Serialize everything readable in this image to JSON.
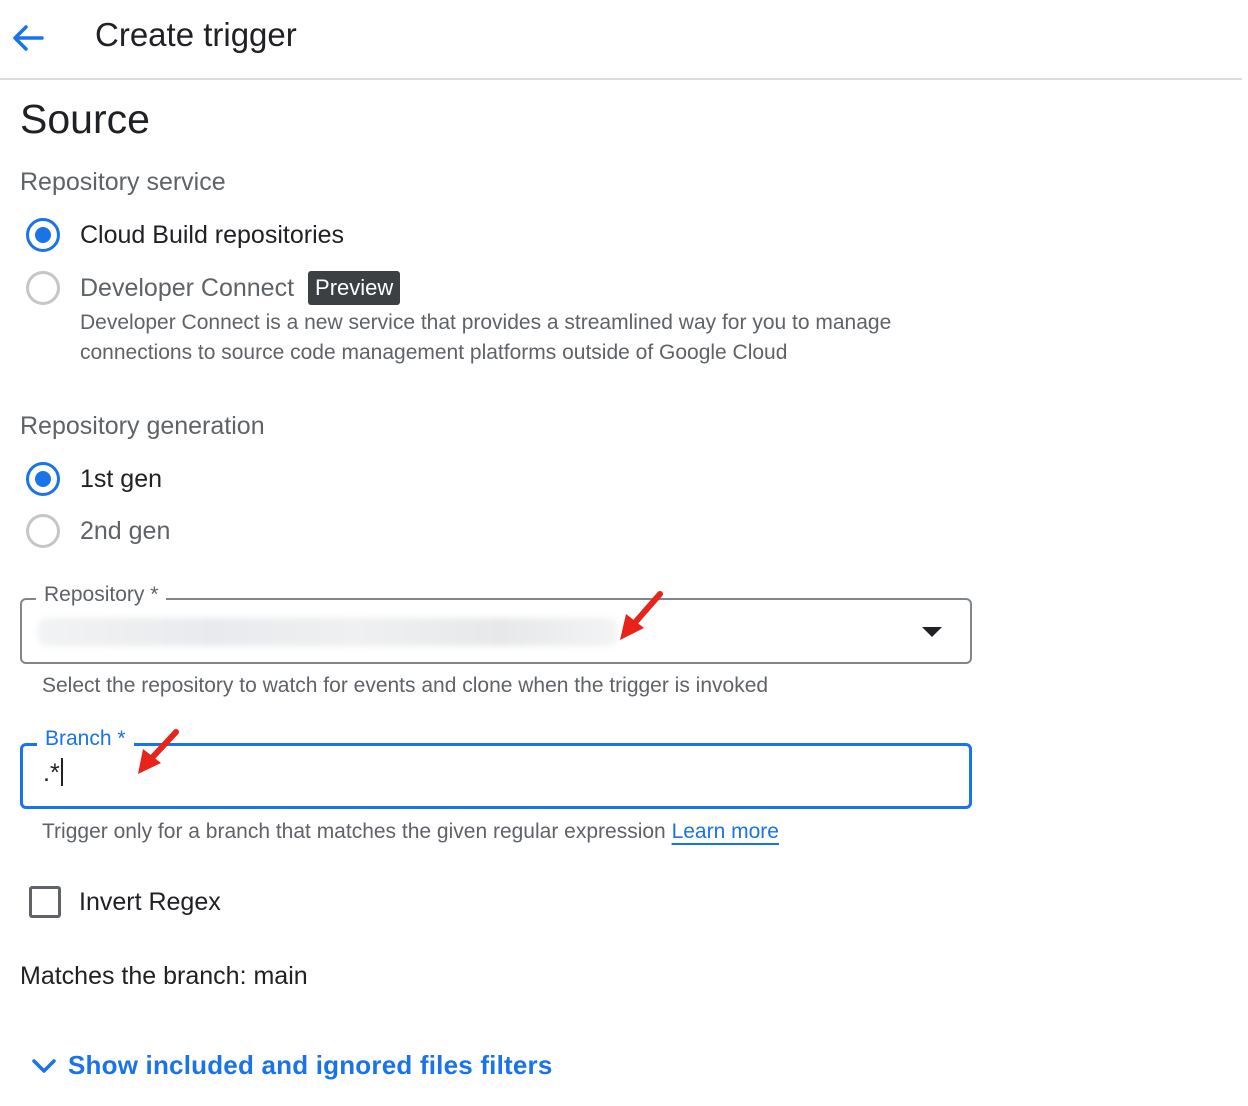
{
  "header": {
    "title": "Create trigger",
    "back_icon": "arrow-back-icon"
  },
  "section": {
    "title": "Source"
  },
  "repository_service": {
    "label": "Repository service",
    "options": [
      {
        "label": "Cloud Build repositories",
        "selected": true
      },
      {
        "label": "Developer Connect",
        "selected": false,
        "badge": "Preview",
        "description": "Developer Connect is a new service that provides a streamlined way for you to manage connections to source code management platforms outside of Google Cloud"
      }
    ]
  },
  "repository_generation": {
    "label": "Repository generation",
    "options": [
      {
        "label": "1st gen",
        "selected": true
      },
      {
        "label": "2nd gen",
        "selected": false
      }
    ]
  },
  "repository_field": {
    "label": "Repository *",
    "value_obscured": true,
    "hint": "Select the repository to watch for events and clone when the trigger is invoked"
  },
  "branch_field": {
    "label": "Branch *",
    "value": ".*",
    "hint": "Trigger only for a branch that matches the given regular expression",
    "learn_more": "Learn more"
  },
  "invert_regex": {
    "label": "Invert Regex",
    "checked": false
  },
  "matches": {
    "text": "Matches the branch: main"
  },
  "filters_toggle": {
    "label": "Show included and ignored files filters",
    "icon": "chevron-down-icon"
  },
  "colors": {
    "accent": "#1a73e8",
    "annotation": "#e8231a",
    "text": "#202124",
    "muted": "#5f6368"
  }
}
